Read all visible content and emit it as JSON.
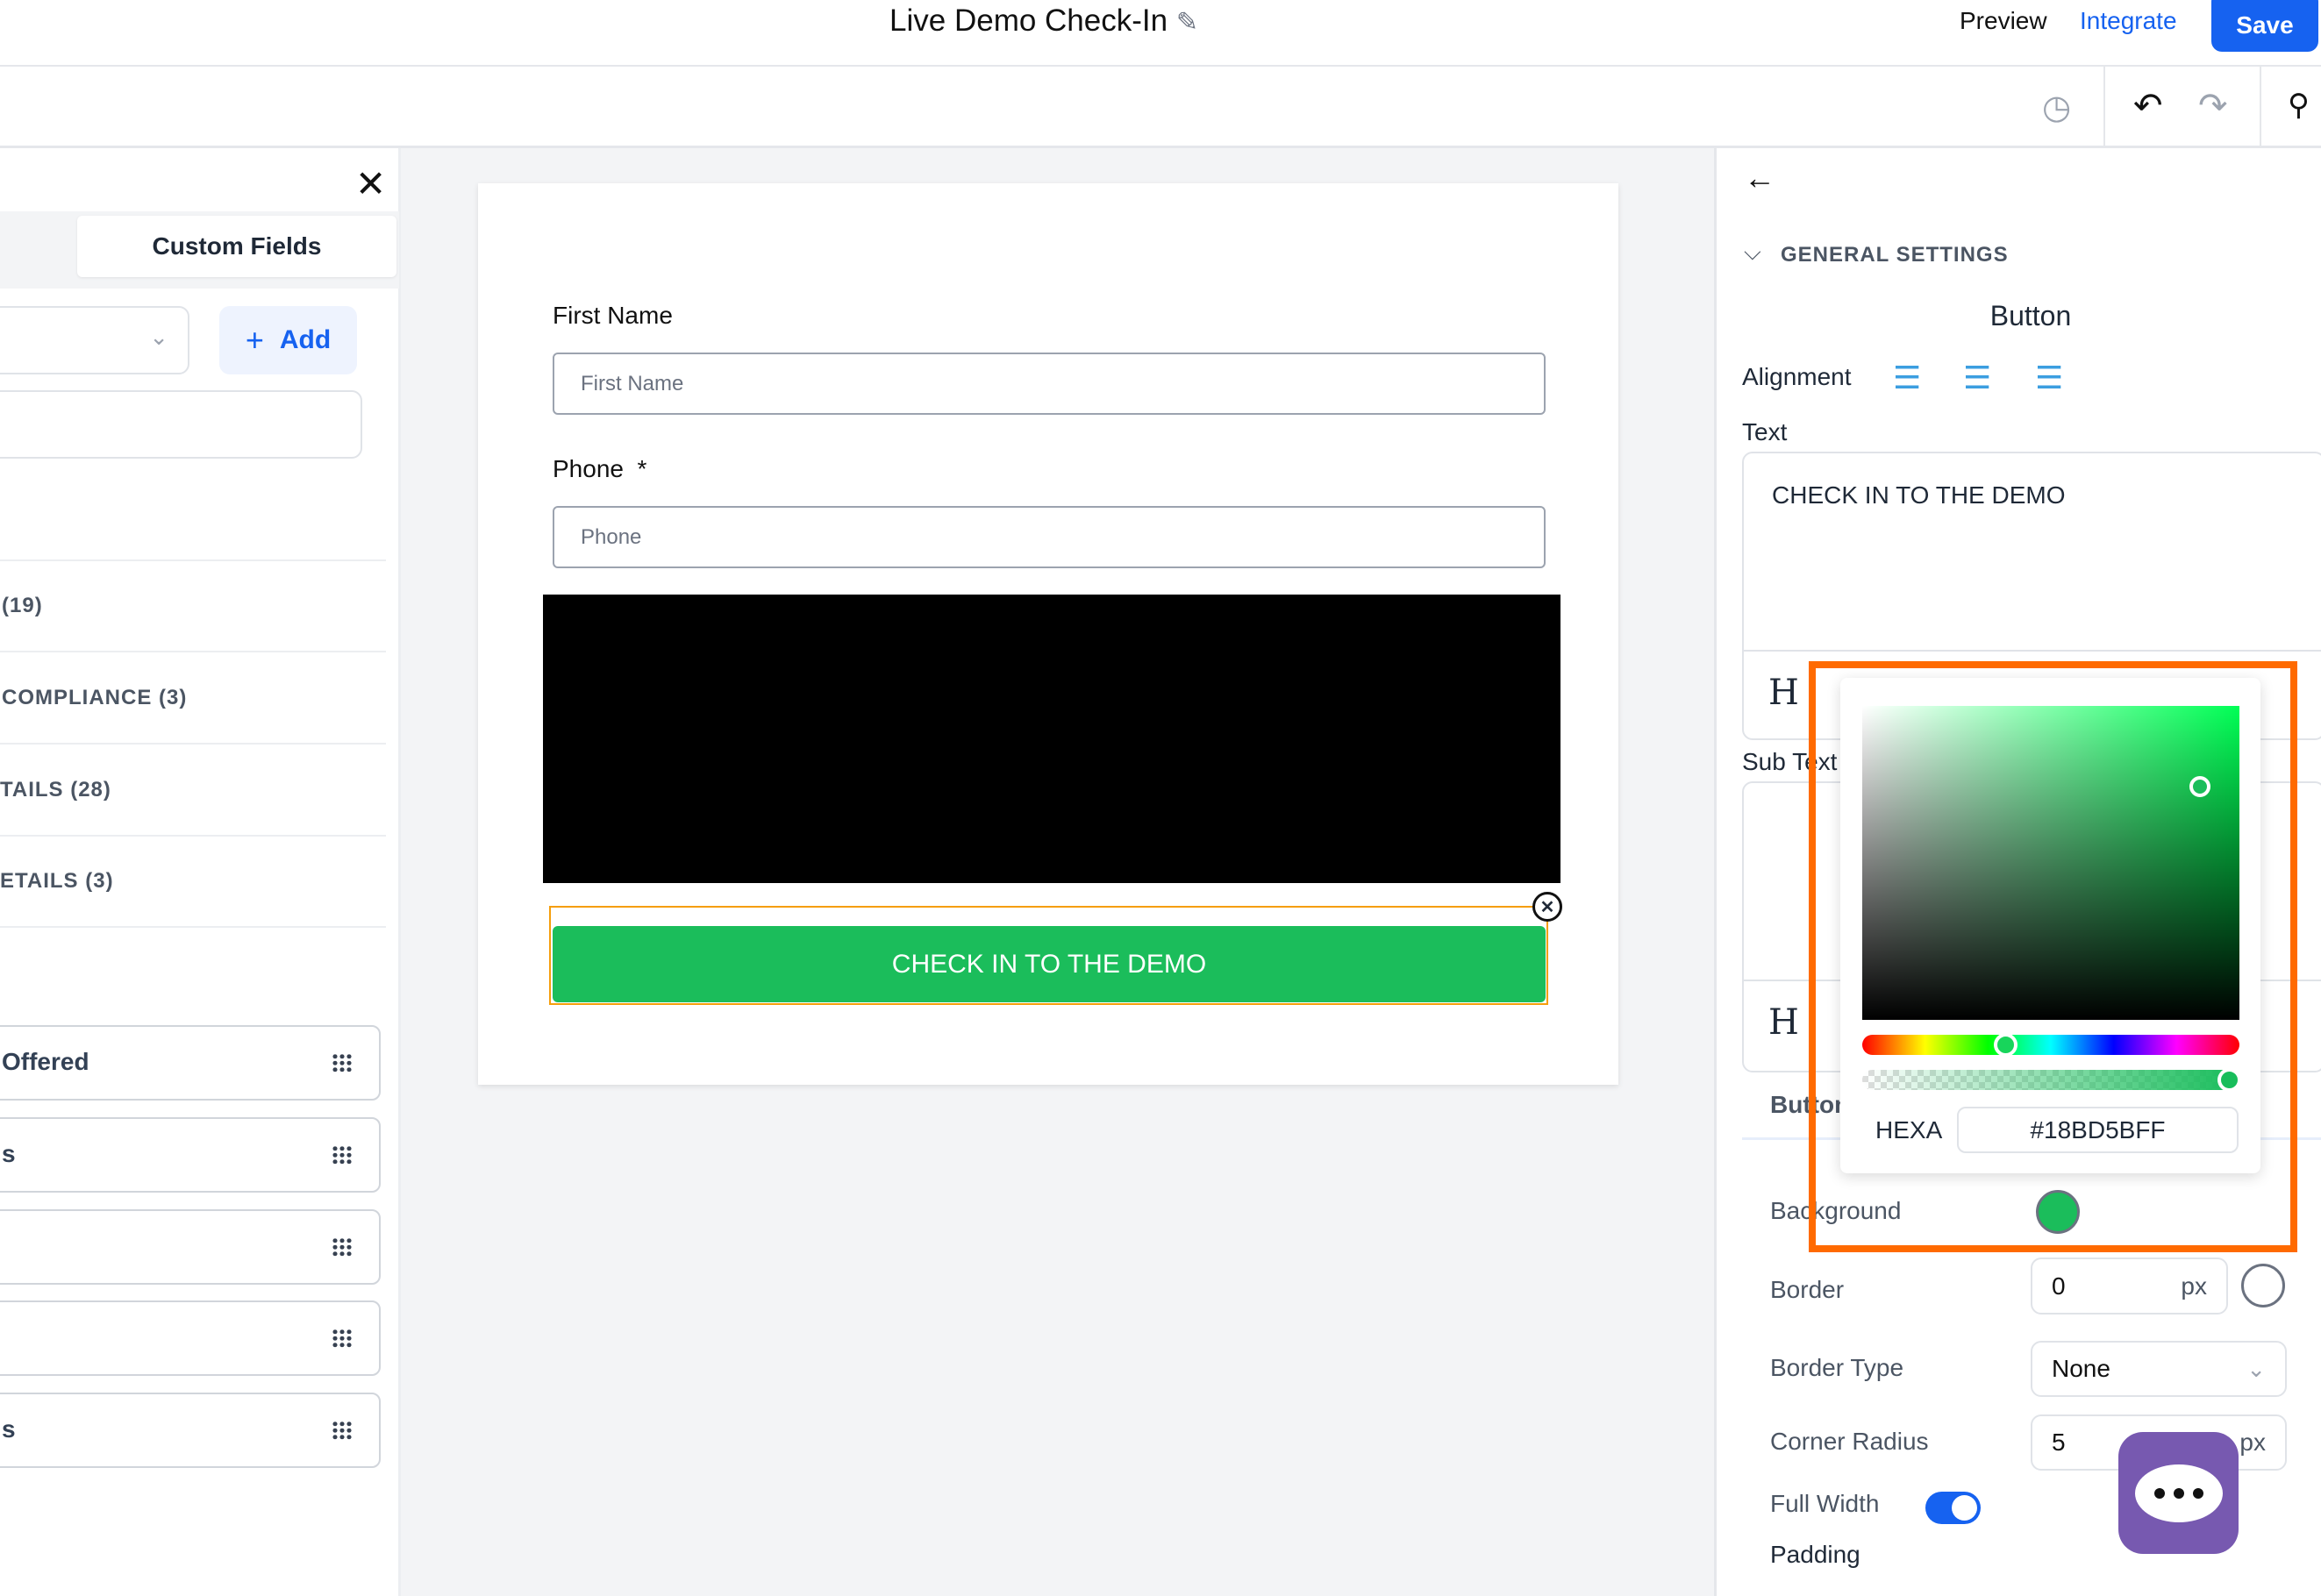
{
  "header": {
    "title": "Live Demo Check-In",
    "preview": "Preview",
    "integrate": "Integrate",
    "save": "Save"
  },
  "left_panel": {
    "tab": "Custom Fields",
    "add_label": "Add",
    "sections": [
      "(19)",
      "COMPLIANCE (3)",
      "TAILS (28)",
      "ETAILS (3)"
    ],
    "fields": [
      "Offered",
      "s",
      "",
      "",
      "s"
    ]
  },
  "form": {
    "first_name_label": "First Name",
    "first_name_placeholder": "First Name",
    "phone_label": "Phone",
    "required_mark": "*",
    "phone_placeholder": "Phone",
    "button_text": "CHECK IN TO THE DEMO",
    "button_color": "#18BD5B"
  },
  "settings": {
    "section": "GENERAL SETTINGS",
    "title": "Button",
    "alignment": "Alignment",
    "text_label": "Text",
    "text_value": "CHECK IN TO THE DEMO",
    "sub_text_label": "Sub Text",
    "button_tab": "Button",
    "background": "Background",
    "border": "Border",
    "border_value": "0",
    "px": "px",
    "border_type": "Border Type",
    "border_type_value": "None",
    "corner_radius": "Corner Radius",
    "corner_radius_value": "5",
    "full_width": "Full Width",
    "full_width_on": true,
    "padding": "Padding"
  },
  "color_picker": {
    "mode": "HEXA",
    "value": "#18BD5BFF",
    "highlight_color": "#FF6A00"
  }
}
